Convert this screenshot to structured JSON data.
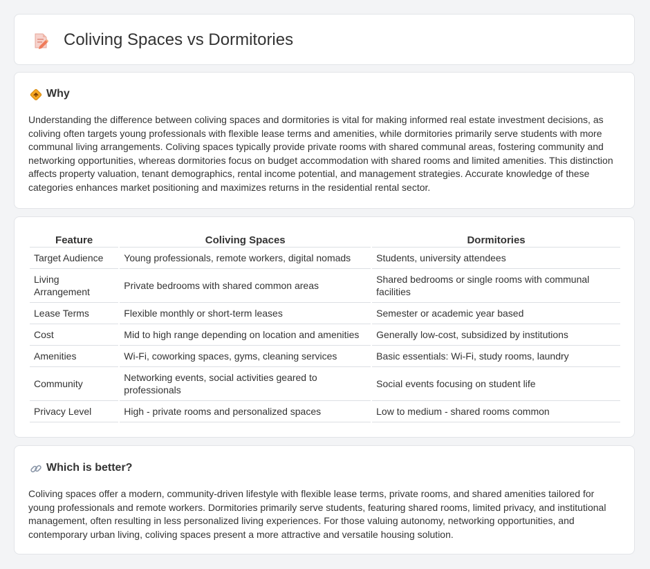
{
  "header": {
    "title": "Coliving Spaces vs Dormitories",
    "icon": "document-pencil-icon"
  },
  "why": {
    "title": "Why",
    "icon": "diamond-sign-icon",
    "body": "Understanding the difference between coliving spaces and dormitories is vital for making informed real estate investment decisions, as coliving often targets young professionals with flexible lease terms and amenities, while dormitories primarily serve students with more communal living arrangements. Coliving spaces typically provide private rooms with shared communal areas, fostering community and networking opportunities, whereas dormitories focus on budget accommodation with shared rooms and limited amenities. This distinction affects property valuation, tenant demographics, rental income potential, and management strategies. Accurate knowledge of these categories enhances market positioning and maximizes returns in the residential rental sector."
  },
  "table": {
    "headers": [
      "Feature",
      "Coliving Spaces",
      "Dormitories"
    ],
    "rows": [
      [
        "Target Audience",
        "Young professionals, remote workers, digital nomads",
        "Students, university attendees"
      ],
      [
        "Living Arrangement",
        "Private bedrooms with shared common areas",
        "Shared bedrooms or single rooms with communal facilities"
      ],
      [
        "Lease Terms",
        "Flexible monthly or short-term leases",
        "Semester or academic year based"
      ],
      [
        "Cost",
        "Mid to high range depending on location and amenities",
        "Generally low-cost, subsidized by institutions"
      ],
      [
        "Amenities",
        "Wi-Fi, coworking spaces, gyms, cleaning services",
        "Basic essentials: Wi-Fi, study rooms, laundry"
      ],
      [
        "Community",
        "Networking events, social activities geared to professionals",
        "Social events focusing on student life"
      ],
      [
        "Privacy Level",
        "High - private rooms and personalized spaces",
        "Low to medium - shared rooms common"
      ]
    ]
  },
  "better": {
    "title": "Which is better?",
    "icon": "link-icon",
    "body": "Coliving spaces offer a modern, community-driven lifestyle with flexible lease terms, private rooms, and shared amenities tailored for young professionals and remote workers. Dormitories primarily serve students, featuring shared rooms, limited privacy, and institutional management, often resulting in less personalized living experiences. For those valuing autonomy, networking opportunities, and contemporary urban living, coliving spaces present a more attractive and versatile housing solution."
  }
}
